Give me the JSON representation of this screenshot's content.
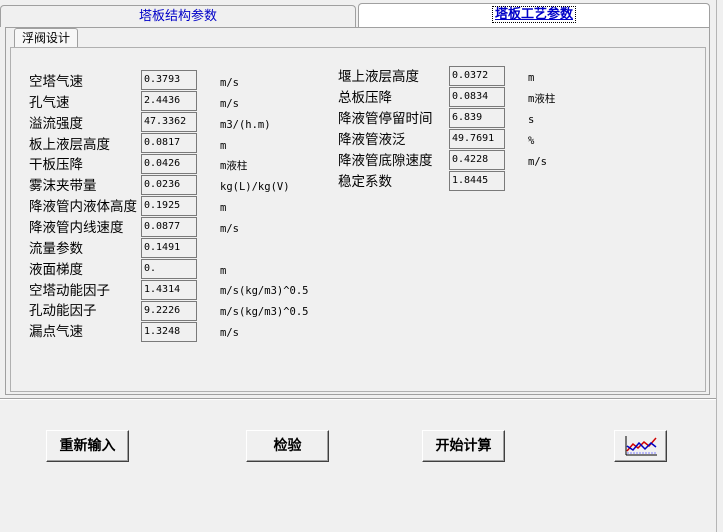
{
  "tabs": [
    "塔板结构参数",
    "塔板工艺参数"
  ],
  "subtab": "浮阀设计",
  "left_rows": [
    {
      "label": "空塔气速",
      "value": "0.3793",
      "unit": "m/s"
    },
    {
      "label": "孔气速",
      "value": "2.4436",
      "unit": "m/s"
    },
    {
      "label": "溢流强度",
      "value": "47.3362",
      "unit": "m3/(h.m)"
    },
    {
      "label": "板上液层高度",
      "value": "0.0817",
      "unit": "m"
    },
    {
      "label": "干板压降",
      "value": "0.0426",
      "unit": "m液柱"
    },
    {
      "label": "雾沫夹带量",
      "value": "0.0236",
      "unit": "kg(L)/kg(V)"
    },
    {
      "label": "降液管内液体高度",
      "value": "0.1925",
      "unit": "m"
    },
    {
      "label": "降液管内线速度",
      "value": "0.0877",
      "unit": "m/s"
    },
    {
      "label": "流量参数",
      "value": "0.1491",
      "unit": ""
    },
    {
      "label": "液面梯度",
      "value": "0.",
      "unit": "m"
    },
    {
      "label": "空塔动能因子",
      "value": "1.4314",
      "unit": "m/s(kg/m3)^0.5"
    },
    {
      "label": "孔动能因子",
      "value": "9.2226",
      "unit": "m/s(kg/m3)^0.5"
    },
    {
      "label": "漏点气速",
      "value": "1.3248",
      "unit": "m/s"
    }
  ],
  "right_rows": [
    {
      "label": "堰上液层高度",
      "value": "0.0372",
      "unit": "m"
    },
    {
      "label": "总板压降",
      "value": "0.0834",
      "unit": "m液柱"
    },
    {
      "label": "降液管停留时间",
      "value": "6.839",
      "unit": "s"
    },
    {
      "label": "降液管液泛",
      "value": "49.7691",
      "unit": "%"
    },
    {
      "label": "降液管底隙速度",
      "value": "0.4228",
      "unit": "m/s"
    },
    {
      "label": "稳定系数",
      "value": "1.8445",
      "unit": ""
    }
  ],
  "buttons": {
    "reset": "重新输入",
    "check": "检验",
    "calculate": "开始计算",
    "chart_icon": "line-chart-icon"
  }
}
